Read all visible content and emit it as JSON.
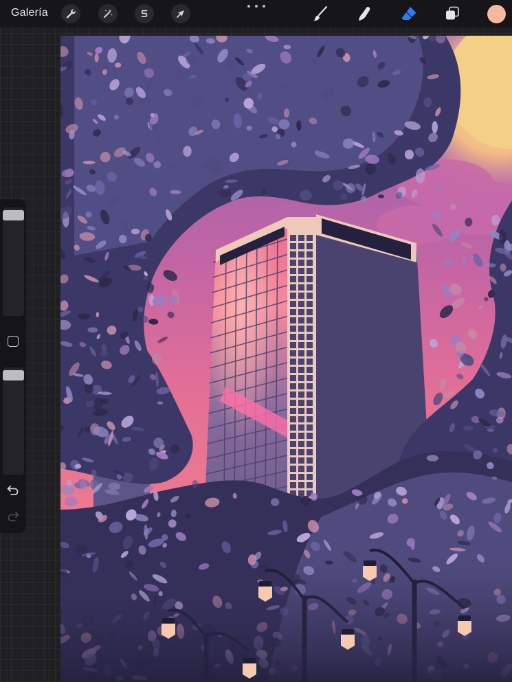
{
  "toolbar": {
    "gallery_label": "Galería",
    "left_tools": [
      {
        "name": "actions",
        "icon": "wrench-icon"
      },
      {
        "name": "adjustments",
        "icon": "magic-wand-icon"
      },
      {
        "name": "selection",
        "icon": "selection-s-icon"
      },
      {
        "name": "transform",
        "icon": "arrow-cursor-icon"
      }
    ],
    "more_icon": "more-dots-icon",
    "right_tools": [
      {
        "name": "brush",
        "icon": "brush-icon"
      },
      {
        "name": "smudge",
        "icon": "smudge-finger-icon"
      },
      {
        "name": "eraser",
        "icon": "eraser-icon",
        "active": true
      },
      {
        "name": "layers",
        "icon": "layers-icon"
      }
    ],
    "current_color": "#f6b9a0",
    "active_tool_color": "#2f7cf6"
  },
  "sidebar": {
    "brush_size_level": 0.0,
    "opacity_level": 0.0,
    "modify_icon": "square-modify-icon",
    "undo_icon": "undo-icon",
    "redo_icon": "redo-icon"
  },
  "artwork": {
    "palette": {
      "sky_top": "#8a63b4",
      "sky_mid": "#d9709b",
      "sky_low": "#f07d8e",
      "sun": "#f6d28a",
      "foliage_dark": "#2e2a4d",
      "foliage_mid": "#4f4b7e",
      "foliage_light": "#8d87c2",
      "tower_face": "#49416e",
      "tower_trim": "#ecc9b8",
      "lamp": "#f7c9ae"
    }
  }
}
